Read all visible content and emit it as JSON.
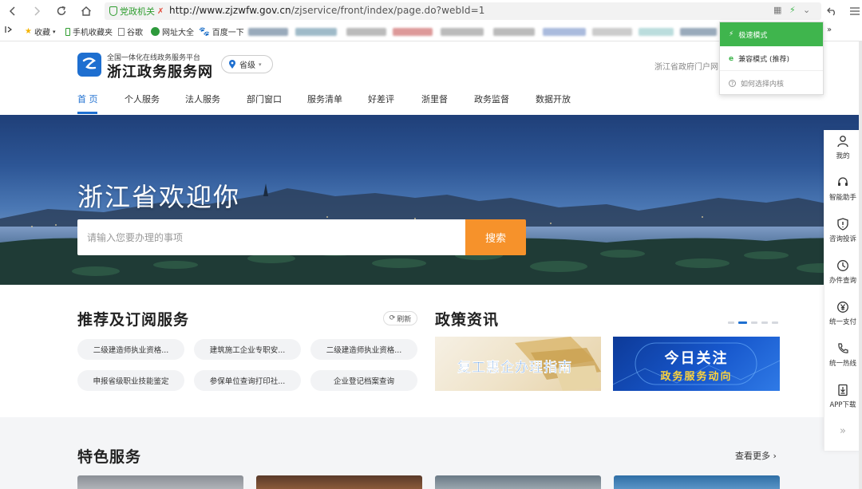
{
  "browser": {
    "gov_label": "党政机关",
    "url_host": "http://www.zjzwfw.gov.cn",
    "url_path": "/zjservice/front/index/page.do?webId=1",
    "bookmarks": [
      "收藏",
      "手机收藏夹",
      "谷歌",
      "网址大全",
      "百度一下"
    ],
    "more": "»"
  },
  "mode_menu": {
    "fast": "极速模式",
    "compat": "兼容模式 (推荐)",
    "howto": "如何选择内核"
  },
  "site": {
    "subtitle": "全国一体化在线政务服务平台",
    "title": "浙江政务服务网",
    "region": "省级",
    "portal": "浙江省政府门户网"
  },
  "nav": [
    "首 页",
    "个人服务",
    "法人服务",
    "部门窗口",
    "服务清单",
    "好差评",
    "浙里督",
    "政务监督",
    "数据开放"
  ],
  "hero": {
    "title": "浙江省欢迎你",
    "search_placeholder": "请输入您要办理的事项",
    "search_button": "搜索"
  },
  "recommend": {
    "title": "推荐及订阅服务",
    "refresh": "刷新",
    "items": [
      "二级建造师执业资格...",
      "建筑施工企业专职安...",
      "二级建造师执业资格...",
      "申报省级职业技能鉴定",
      "参保单位查询打印社...",
      "企业登记档案查询"
    ]
  },
  "policy": {
    "title": "政策资讯",
    "banner1": "复工惠企办理指南",
    "banner2_line1": "今日关注",
    "banner2_line2": "政务服务动向"
  },
  "feature": {
    "title": "特色服务",
    "more": "查看更多"
  },
  "rightbar": [
    "我的",
    "智能助手",
    "咨询投诉",
    "办件查询",
    "统一支付",
    "统一热线",
    "APP下载"
  ],
  "colors": {
    "brand_blue": "#1e6fd0",
    "search_orange": "#f6922b",
    "fast_mode_green": "#3fb54d"
  }
}
